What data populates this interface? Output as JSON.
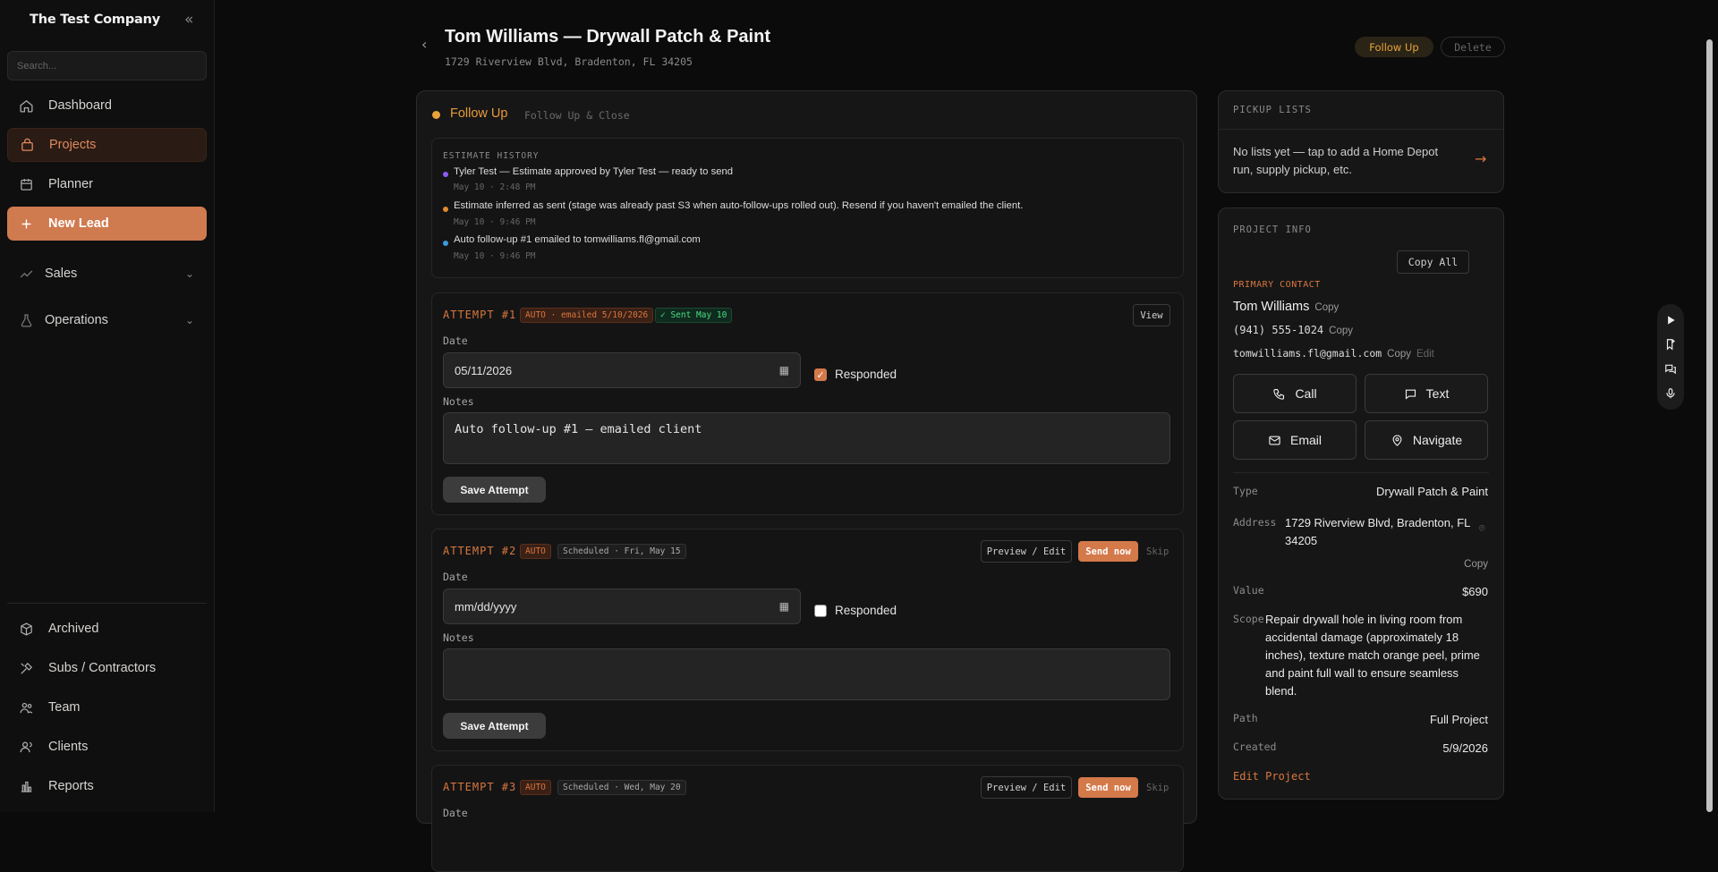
{
  "sidebar": {
    "company": "The Test Company",
    "search_placeholder": "Search...",
    "items": [
      {
        "label": "Dashboard"
      },
      {
        "label": "Projects"
      },
      {
        "label": "Planner"
      },
      {
        "label": "New Lead"
      },
      {
        "label": "Sales"
      },
      {
        "label": "Operations"
      }
    ],
    "bottom": [
      {
        "label": "Archived"
      },
      {
        "label": "Subs / Contractors"
      },
      {
        "label": "Team"
      },
      {
        "label": "Clients"
      },
      {
        "label": "Reports"
      }
    ]
  },
  "header": {
    "title": "Tom Williams — Drywall Patch & Paint",
    "address": "1729 Riverview Blvd, Bradenton, FL 34205",
    "status_pill": "Follow Up",
    "delete_label": "Delete"
  },
  "stage": {
    "label": "Follow Up",
    "sub": "Follow Up & Close"
  },
  "history": {
    "title": "ESTIMATE HISTORY",
    "items": [
      {
        "text": "Tyler Test — Estimate approved by Tyler Test — ready to send",
        "time": "May 10 · 2:48 PM",
        "color": "#8b5cf6"
      },
      {
        "text": "Estimate inferred as sent (stage was already past S3 when auto-follow-ups rolled out). Resend if you haven't emailed the client.",
        "time": "May 10 · 9:46 PM",
        "color": "#e08a2c"
      },
      {
        "text": "Auto follow-up #1 emailed to tomwilliams.fl@gmail.com",
        "time": "May 10 · 9:46 PM",
        "color": "#3b9be0"
      }
    ]
  },
  "attempts": [
    {
      "title": "ATTEMPT #1",
      "tag1": "AUTO · emailed 5/10/2026",
      "tag2": "✓ Sent May 10",
      "view": "View",
      "date_label": "Date",
      "date": "05/11/2026",
      "responded_label": "Responded",
      "notes_label": "Notes",
      "notes": "Auto follow-up #1 — emailed client",
      "save": "Save Attempt"
    },
    {
      "title": "ATTEMPT #2",
      "tag1": "AUTO",
      "tag2": "Scheduled · Fri, May 15",
      "preview": "Preview / Edit",
      "send": "Send now",
      "skip": "Skip",
      "date_label": "Date",
      "date": "mm/dd/yyyy",
      "responded_label": "Responded",
      "notes_label": "Notes",
      "notes": "",
      "save": "Save Attempt"
    },
    {
      "title": "ATTEMPT #3",
      "tag1": "AUTO",
      "tag2": "Scheduled · Wed, May 20",
      "preview": "Preview / Edit",
      "send": "Send now",
      "skip": "Skip",
      "date_label": "Date"
    }
  ],
  "pickup": {
    "title": "PICKUP LISTS",
    "text": "No lists yet — tap to add a Home Depot run, supply pickup, etc.",
    "arrow": "→"
  },
  "info": {
    "title": "PROJECT INFO",
    "copy_all": "Copy All",
    "primary_label": "PRIMARY CONTACT",
    "name": "Tom Williams",
    "phone": "(941) 555-1024",
    "email": "tomwilliams.fl@gmail.com",
    "copy": "Copy",
    "edit": "Edit",
    "actions": {
      "call": "Call",
      "text": "Text",
      "email": "Email",
      "navigate": "Navigate"
    },
    "type_k": "Type",
    "type_v": "Drywall Patch & Paint",
    "address_k": "Address",
    "address_v": "1729 Riverview Blvd, Bradenton, FL 34205",
    "value_k": "Value",
    "value_v": "$690",
    "scope_k": "Scope",
    "scope_v": "Repair drywall hole in living room from accidental damage (approximately 18 inches), texture match orange peel, prime and paint full wall to ensure seamless blend.",
    "path_k": "Path",
    "path_v": "Full Project",
    "created_k": "Created",
    "created_v": "5/9/2026",
    "edit_project": "Edit Project"
  },
  "colors": {
    "accent": "#cf7a4f",
    "follow_up": "#e8a33a",
    "bg": "#0b0b0b"
  }
}
